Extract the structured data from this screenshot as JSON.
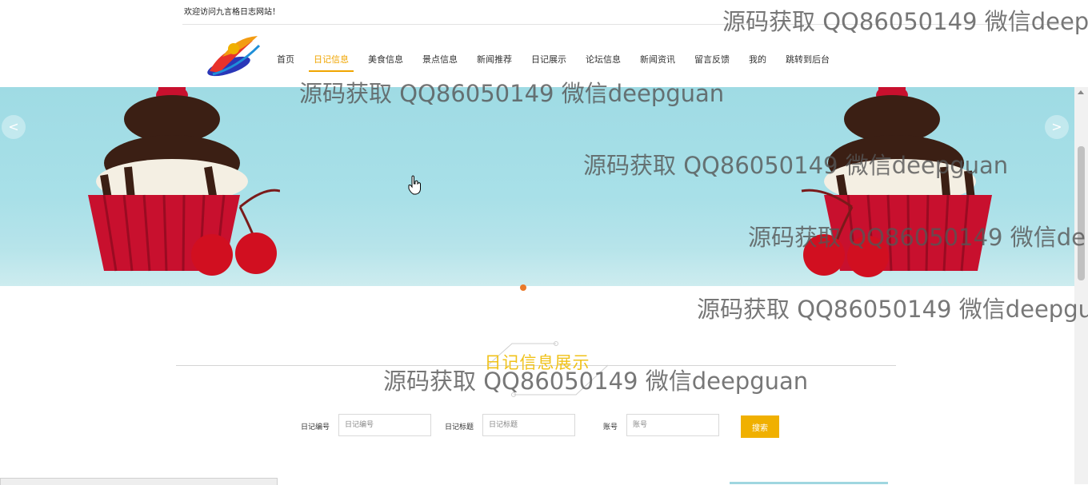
{
  "header": {
    "welcome": "欢迎访问九言格日志网站！",
    "nav": [
      {
        "label": "首页",
        "name": "nav-home"
      },
      {
        "label": "日记信息",
        "name": "nav-diary-info",
        "active": true
      },
      {
        "label": "美食信息",
        "name": "nav-food-info"
      },
      {
        "label": "景点信息",
        "name": "nav-scenic-info"
      },
      {
        "label": "新闻推荐",
        "name": "nav-news-recommend"
      },
      {
        "label": "日记展示",
        "name": "nav-diary-show"
      },
      {
        "label": "论坛信息",
        "name": "nav-forum-info"
      },
      {
        "label": "新闻资讯",
        "name": "nav-news-info"
      },
      {
        "label": "留言反馈",
        "name": "nav-feedback"
      },
      {
        "label": "我的",
        "name": "nav-mine"
      },
      {
        "label": "跳转到后台",
        "name": "nav-admin"
      }
    ]
  },
  "banner": {
    "prev_label": "<",
    "next_label": ">",
    "slides": 3,
    "active_slide": 1
  },
  "section": {
    "title": "日记信息展示"
  },
  "search": {
    "field1_label": "日记编号",
    "field1_placeholder": "日记编号",
    "field2_label": "日记标题",
    "field2_placeholder": "日记标题",
    "field3_label": "账号",
    "field3_placeholder": "账号",
    "button_label": "搜索"
  },
  "watermark": {
    "full": "源码获取 QQ86050149 微信deepguan",
    "cut1": "源码获取 QQ86050149 微信deep",
    "cut2": "源码获取 QQ86050149 微信de",
    "cut3": "源码获取 QQ86050149 微信deepgu"
  },
  "colors": {
    "accent": "#f0a500",
    "title": "#f0c21a",
    "button": "#f0b000",
    "banner_bg": "#a5dee6",
    "dot_active": "#ea7a2a"
  }
}
